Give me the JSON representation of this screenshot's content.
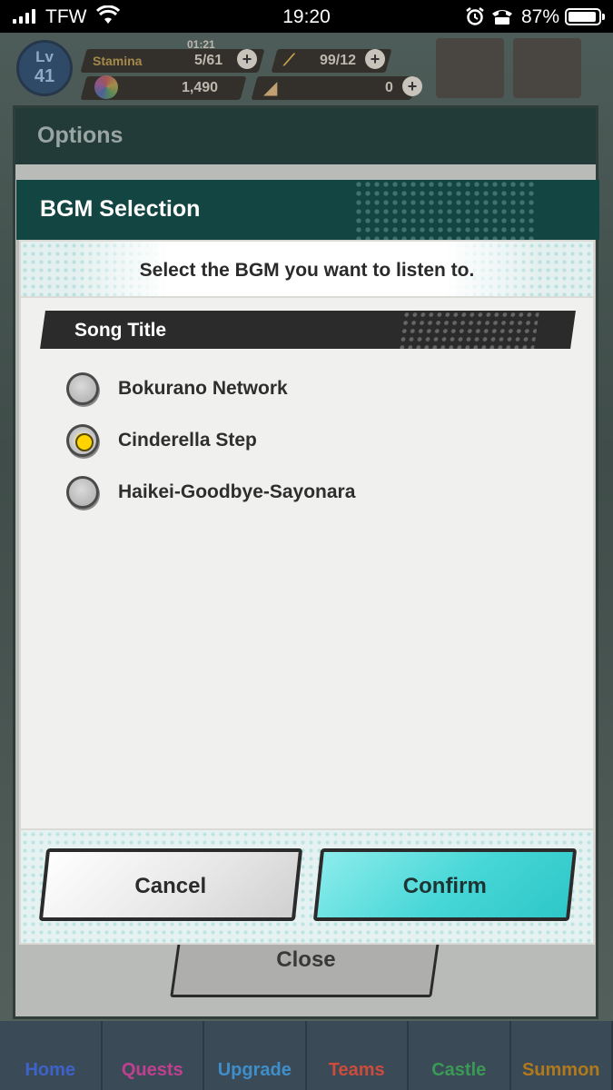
{
  "status_bar": {
    "carrier": "TFW",
    "time": "19:20",
    "battery_pct": "87%"
  },
  "hud": {
    "level_label": "Lv",
    "level": "41",
    "stamina_label": "Stamina",
    "stamina_timer": "01:21",
    "stamina_value": "5/61",
    "item_value": "99/12",
    "gems_value": "1,490",
    "tickets_value": "0"
  },
  "bottom_nav": [
    {
      "label": "Home",
      "color": "#3d63c9"
    },
    {
      "label": "Quests",
      "color": "#c04090"
    },
    {
      "label": "Upgrade",
      "color": "#3f8ec9"
    },
    {
      "label": "Teams",
      "color": "#cc4c3b"
    },
    {
      "label": "Castle",
      "color": "#3a9a55"
    },
    {
      "label": "Summon",
      "color": "#b07a1c"
    }
  ],
  "options_panel": {
    "title": "Options",
    "close_label": "Close"
  },
  "dialog": {
    "title": "BGM Selection",
    "instruction": "Select the BGM you want to listen to.",
    "column_header": "Song Title",
    "songs": [
      {
        "title": "Bokurano Network",
        "selected": false
      },
      {
        "title": "Cinderella Step",
        "selected": true
      },
      {
        "title": "Haikei-Goodbye-Sayonara",
        "selected": false
      }
    ],
    "cancel_label": "Cancel",
    "confirm_label": "Confirm"
  }
}
